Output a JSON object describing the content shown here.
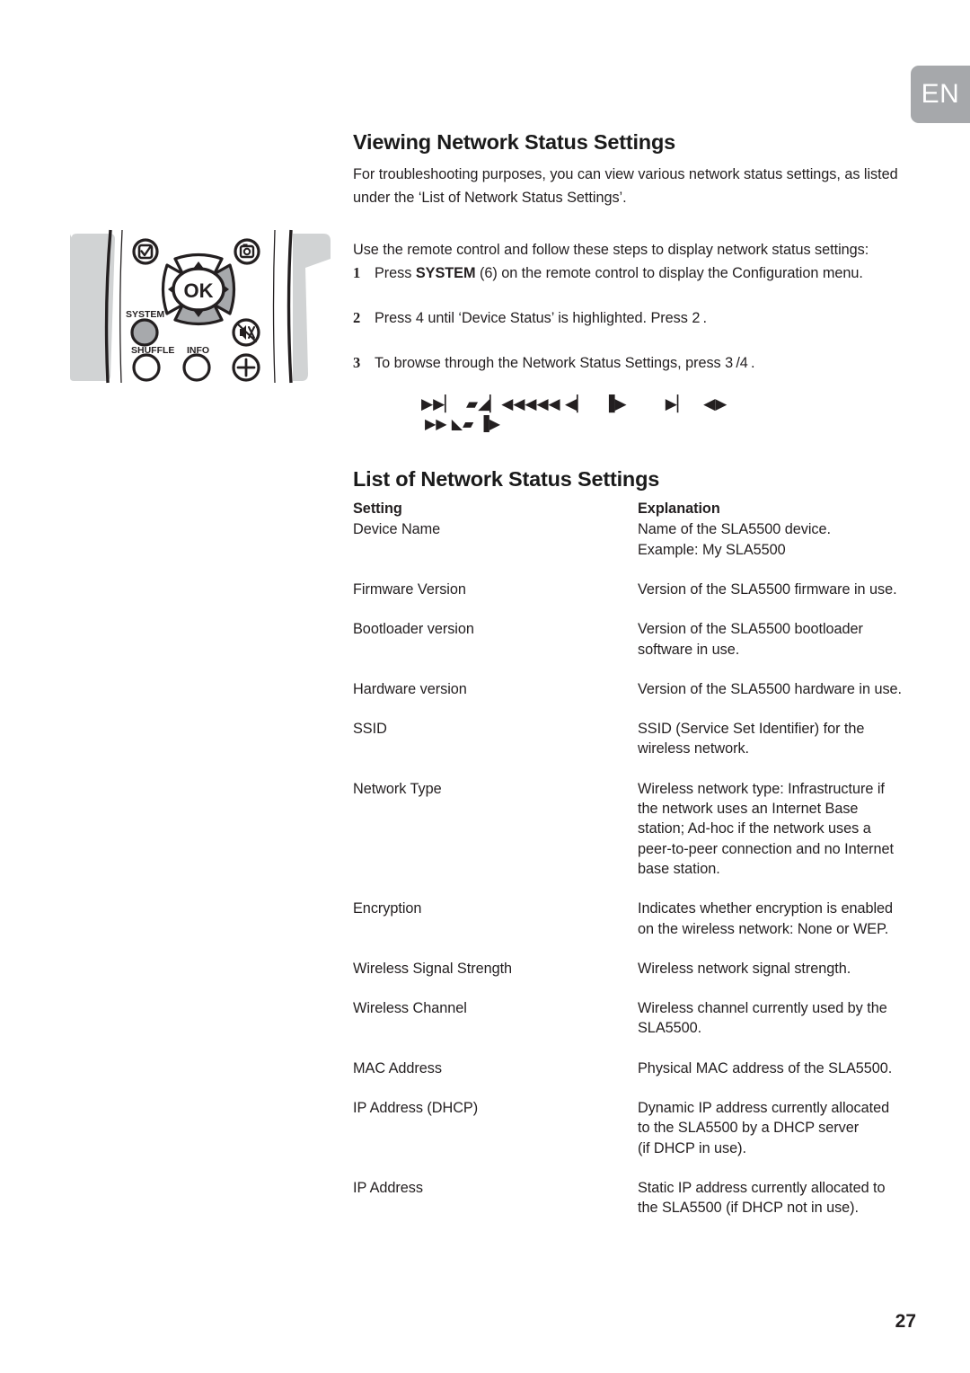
{
  "language_tab": {
    "label": "EN"
  },
  "page": {
    "number": "27"
  },
  "section": {
    "title": "Viewing Network Status Settings",
    "intro": "For troubleshooting purposes, you can view various network status settings, as listed under the ‘List of Network Status Settings’.",
    "lead_in": "Use the remote control and follow these steps to display network status settings:",
    "steps": [
      {
        "num": "1",
        "pre": "Press ",
        "bold": "SYSTEM",
        "post": " (6) on the remote control to display the Configuration menu."
      },
      {
        "num": "2",
        "pre": "Press 4  until ‘Device Status’ is highlighted. Press 2 .",
        "bold": "",
        "post": ""
      },
      {
        "num": "3",
        "pre": "To browse through the Network Status Settings, press 3 /4 .",
        "bold": "",
        "post": ""
      }
    ],
    "glyph_rows": [
      "▶▶▏  ▰◢▏◀◀◀◀◀ ◀▏   ▐▶        ▶▏   ◀▶",
      "▶▶ ◣▰ ▐▶"
    ]
  },
  "list_section": {
    "title": "List of Network Status Settings",
    "columns": {
      "setting": "Setting",
      "explanation": "Explanation"
    },
    "rows": [
      {
        "setting": "Device Name",
        "explanation": [
          "Name of the SLA5500 device.",
          "Example: My SLA5500"
        ]
      },
      {
        "setting": "Firmware Version",
        "explanation": [
          "Version of the SLA5500 firmware in use."
        ]
      },
      {
        "setting": "Bootloader version",
        "explanation": [
          "Version of the SLA5500 bootloader",
          "software in use."
        ]
      },
      {
        "setting": "Hardware version",
        "explanation": [
          "Version of the SLA5500 hardware in use."
        ]
      },
      {
        "setting": "SSID",
        "explanation": [
          "SSID (Service Set Identifier) for the",
          "wireless network."
        ]
      },
      {
        "setting": "Network Type",
        "explanation": [
          "Wireless network type: Infrastructure if",
          "the network uses an Internet Base",
          "station; Ad-hoc if the network uses a",
          "peer-to-peer connection and no Internet",
          "base station."
        ]
      },
      {
        "setting": "Encryption",
        "explanation": [
          "Indicates whether encryption is enabled",
          "on the wireless network: None or WEP."
        ]
      },
      {
        "setting": "Wireless Signal Strength",
        "explanation": [
          "Wireless network signal strength."
        ]
      },
      {
        "setting": "Wireless Channel",
        "explanation": [
          "Wireless channel currently used by the",
          "SLA5500."
        ]
      },
      {
        "setting": "MAC Address",
        "explanation": [
          "Physical MAC address of the SLA5500."
        ]
      },
      {
        "setting": "IP Address (DHCP)",
        "explanation": [
          "Dynamic IP address currently allocated",
          "to the SLA5500 by a DHCP server",
          "(if DHCP in use)."
        ]
      },
      {
        "setting": "IP Address",
        "explanation": [
          "Static IP address currently allocated to",
          "the SLA5500 (if DHCP not in use)."
        ]
      }
    ]
  },
  "remote": {
    "buttons": {
      "ok": "OK",
      "system": "SYSTEM",
      "shuffle": "SHUFFLE",
      "info": "INFO"
    }
  },
  "colors": {
    "tab_background": "#a6a8ab",
    "tab_text": "#ffffff",
    "body_text": "#231f20",
    "remote_body_gray": "#d1d3d4",
    "remote_button_gray": "#a7a9ac"
  }
}
